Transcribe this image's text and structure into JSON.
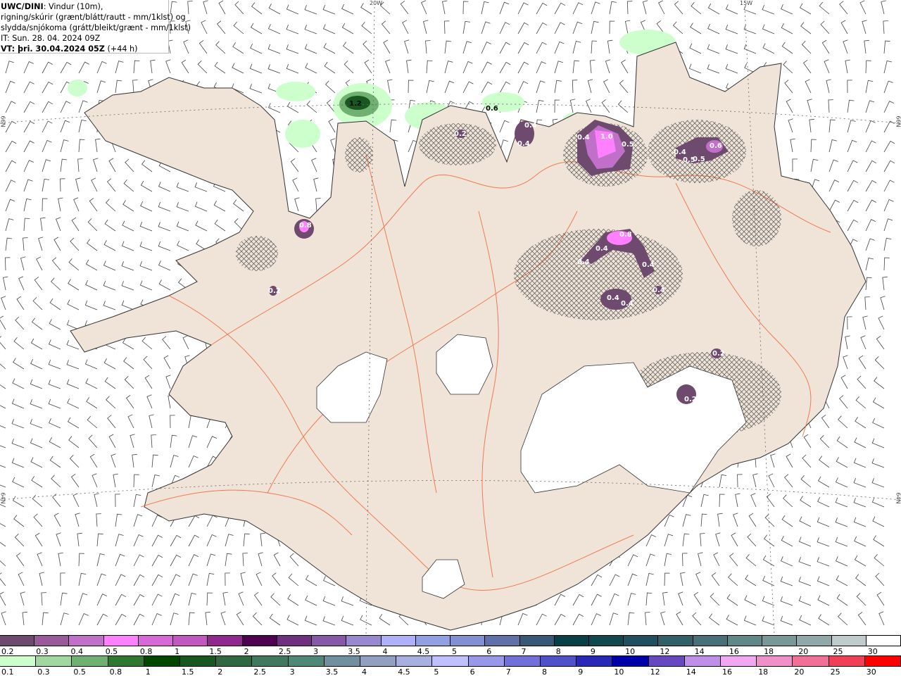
{
  "title": {
    "model": "UWC/DINI",
    "line1_rest": ": Vindur (10m),",
    "line2": "rigning/skúrir (grænt/blátt/rautt - mm/1klst) og",
    "line3": "slydda/snjókoma (grátt/bleikt/grænt - mm/1klst)",
    "issue_time": "IT: Sun. 28. 04. 2024 09Z",
    "valid_label": "VT: þri. 30.04.2024 05Z",
    "lead": " (+44 h)"
  },
  "graticule": {
    "lon1": "20W",
    "lon2": "15W",
    "lat1_left": "66N",
    "lat2_left": "64N",
    "lat1_right": "66N",
    "lat2_right": "64N"
  },
  "contour_labels": [
    "1.2",
    "0.6",
    "0.2",
    "0.4",
    "0.4",
    "0.8",
    "0.4",
    "1.0",
    "0.5",
    "0.4",
    "0.5",
    "0.5",
    "0.6",
    "0.8",
    "0.4",
    "0.4",
    "0.4",
    "0.4",
    "0.4",
    "0.4",
    "0.2",
    "0.2",
    "0.2"
  ],
  "legend_snow": {
    "labels": [
      "0.2",
      "0.3",
      "0.4",
      "0.5",
      "0.8",
      "1",
      "1.5",
      "2",
      "2.5",
      "3",
      "3.5",
      "4",
      "4.5",
      "5",
      "6",
      "7",
      "8",
      "9",
      "10",
      "12",
      "14",
      "16",
      "18",
      "20",
      "25",
      "30"
    ],
    "colors": [
      "#6e4a6e",
      "#9a5a9a",
      "#c070c8",
      "#ff80ff",
      "#d868d8",
      "#c058c0",
      "#902890",
      "#500050",
      "#703080",
      "#8858a8",
      "#9888d0",
      "#b0b0f8",
      "#90a0e0",
      "#8090d0",
      "#6070a8",
      "#385878",
      "#084048",
      "#104850",
      "#205060",
      "#306068",
      "#487078",
      "#608888",
      "#789898",
      "#90a8a8",
      "#c0cccc",
      "#ffffff"
    ]
  },
  "legend_rain": {
    "labels": [
      "0.1",
      "0.3",
      "0.5",
      "0.8",
      "1",
      "1.5",
      "2",
      "2.5",
      "3",
      "3.5",
      "4",
      "4.5",
      "5",
      "6",
      "7",
      "8",
      "9",
      "10",
      "12",
      "14",
      "16",
      "18",
      "20",
      "25",
      "30"
    ],
    "colors": [
      "#ccffcc",
      "#a0d8a0",
      "#70b070",
      "#307830",
      "#004800",
      "#185820",
      "#306840",
      "#407860",
      "#508878",
      "#7090a0",
      "#90a0c0",
      "#a8b0e0",
      "#c0c0ff",
      "#9898e8",
      "#7070d8",
      "#5050c8",
      "#2828b8",
      "#0000a8",
      "#6848c0",
      "#c090e8",
      "#f0a8f0",
      "#f090c8",
      "#f07098",
      "#f04058",
      "#ff0000"
    ]
  },
  "colors": {
    "land": "#f0e4d8",
    "glacier": "#ffffff",
    "roads": "#f06030",
    "wind_barb": "#444444"
  }
}
